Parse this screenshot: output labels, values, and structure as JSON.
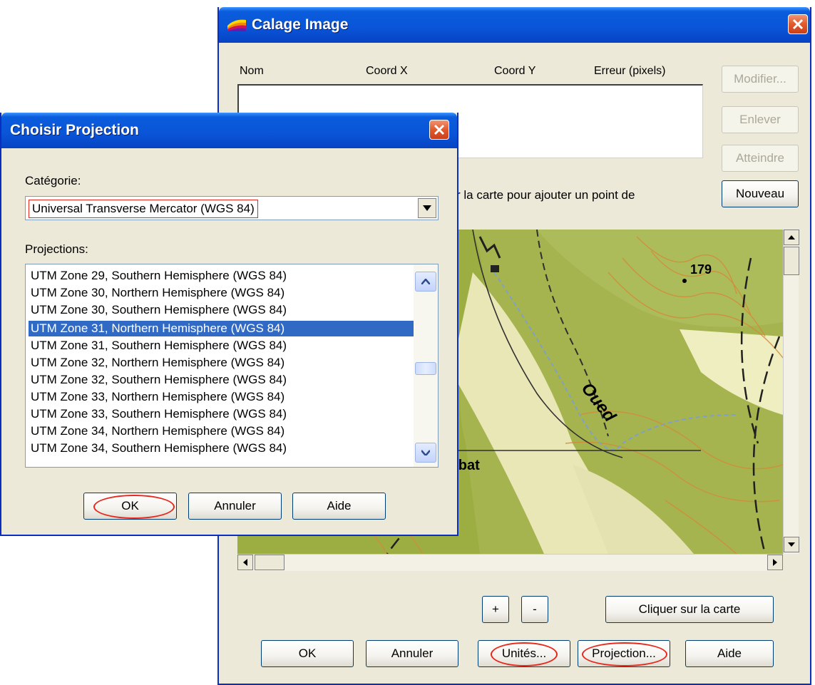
{
  "calage": {
    "title": "Calage Image",
    "columns": [
      "Nom",
      "Coord X",
      "Coord Y",
      "Erreur (pixels)"
    ],
    "side_buttons": {
      "modifier": "Modifier...",
      "enlever": "Enlever",
      "atteindre": "Atteindre",
      "nouveau": "Nouveau"
    },
    "hint": "r la carte pour ajouter un point de",
    "map_labels": {
      "elevation": "179",
      "river": "Oued",
      "place": "rbat"
    },
    "zoom_in": "+",
    "zoom_out": "-",
    "click_map": "Cliquer sur la carte",
    "buttons": {
      "ok": "OK",
      "cancel": "Annuler",
      "units": "Unités...",
      "projection": "Projection...",
      "help": "Aide"
    }
  },
  "choisir": {
    "title": "Choisir Projection",
    "category_label": "Catégorie:",
    "category_value": "Universal Transverse Mercator (WGS 84)",
    "projections_label": "Projections:",
    "projections": [
      "UTM Zone 29, Southern Hemisphere (WGS 84)",
      "UTM Zone 30, Northern Hemisphere (WGS 84)",
      "UTM Zone 30, Southern Hemisphere (WGS 84)",
      "UTM Zone 31, Northern Hemisphere (WGS 84)",
      "UTM Zone 31, Southern Hemisphere (WGS 84)",
      "UTM Zone 32, Northern Hemisphere (WGS 84)",
      "UTM Zone 32, Southern Hemisphere (WGS 84)",
      "UTM Zone 33, Northern Hemisphere (WGS 84)",
      "UTM Zone 33, Southern Hemisphere (WGS 84)",
      "UTM Zone 34, Northern Hemisphere (WGS 84)",
      "UTM Zone 34, Southern Hemisphere (WGS 84)"
    ],
    "selected_projection": "UTM Zone 31, Northern Hemisphere (WGS 84)",
    "buttons": {
      "ok": "OK",
      "cancel": "Annuler",
      "help": "Aide"
    }
  },
  "colors": {
    "titlebar": "#0a54d8",
    "selection": "#316ac5",
    "annotation": "#e8281c",
    "dialog_bg": "#ece9d8"
  }
}
